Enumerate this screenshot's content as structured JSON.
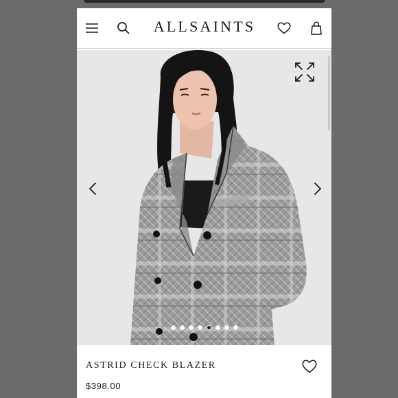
{
  "header": {
    "brand": "ALLSAINTS",
    "menu_icon": "hamburger-menu-icon",
    "search_icon": "search-icon",
    "wishlist_icon": "heart-icon",
    "bag_icon": "shopping-bag-icon"
  },
  "gallery": {
    "expand_icon": "expand-arrows-icon",
    "prev_icon": "chevron-left-icon",
    "next_icon": "chevron-right-icon",
    "image_count": 8,
    "active_index": 4,
    "image": "model wearing grey check blazer"
  },
  "product": {
    "name": "ASTRID CHECK BLAZER",
    "price": "$398.00",
    "wishlist_icon": "heart-outline-icon"
  },
  "colors": {
    "background": "#6b6b6b",
    "text": "#1a1a1a",
    "gallery_bg": "#e6e7e9"
  }
}
